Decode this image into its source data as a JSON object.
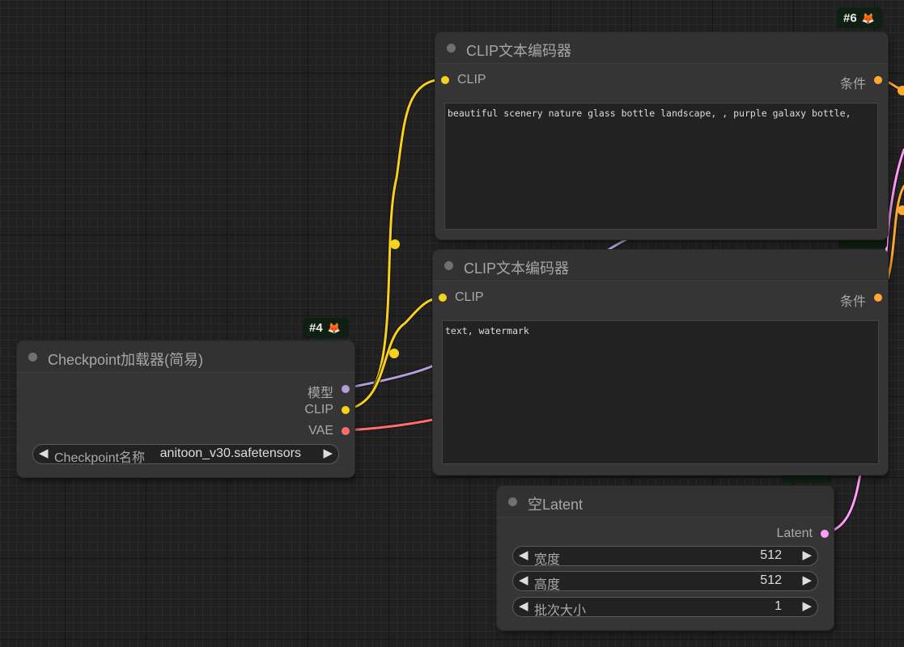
{
  "colors": {
    "clip": "#f7d11c",
    "model": "#b39ddb",
    "vae": "#ff6e6e",
    "conditioning": "#ffa931",
    "latent": "#ff9cf9"
  },
  "nodes": {
    "clip_encoder_top": {
      "title": "CLIP文本编码器",
      "badge": "#6",
      "input_label": "CLIP",
      "output_label": "条件",
      "text": "beautiful scenery nature glass bottle landscape, , purple galaxy bottle,"
    },
    "clip_encoder_bottom": {
      "title": "CLIP文本编码器",
      "input_label": "CLIP",
      "output_label": "条件",
      "text": "text, watermark"
    },
    "checkpoint_loader": {
      "title": "Checkpoint加载器(简易)",
      "badge": "#4",
      "outputs": [
        "模型",
        "CLIP",
        "VAE"
      ],
      "widget_label": "Checkpoint名称",
      "widget_value": "anitoon_v30.safetensors"
    },
    "empty_latent": {
      "title": "空Latent",
      "output_label": "Latent",
      "widgets": [
        {
          "label": "宽度",
          "value": "512"
        },
        {
          "label": "高度",
          "value": "512"
        },
        {
          "label": "批次大小",
          "value": "1"
        }
      ]
    }
  },
  "icons": {
    "badge_icon": "fox-icon",
    "widget_left": "◀",
    "widget_right": "▶"
  }
}
